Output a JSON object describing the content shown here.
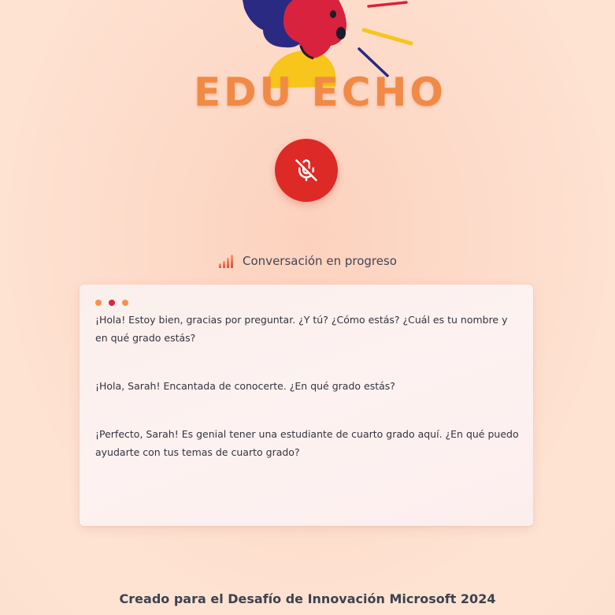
{
  "app": {
    "title": "EDU ECHO"
  },
  "mic": {
    "state": "muted",
    "icon": "mic-off-icon",
    "color": "#dd2a26"
  },
  "status": {
    "icon": "signal-bars-icon",
    "text": "Conversación en progreso"
  },
  "chat": {
    "window_dots": [
      "#f4944c",
      "#d92a3e",
      "#f4944c"
    ],
    "messages": [
      {
        "text": "¡Hola! Estoy bien, gracias por preguntar. ¿Y tú? ¿Cómo estás? ¿Cuál es tu nombre y en qué grado estás?"
      },
      {
        "text": "¡Hola, Sarah! Encantada de conocerte. ¿En qué grado estás?"
      },
      {
        "text": "¡Perfecto, Sarah! Es genial tener una estudiante de cuarto grado aquí. ¿En qué puedo ayudarte con tus temas de cuarto grado?"
      }
    ]
  },
  "footer": {
    "text": "Creado para el Desafío de Innovación Microsoft 2024"
  },
  "colors": {
    "accent_orange": "#f08a46",
    "mic_red": "#dd2a26",
    "logo_navy": "#2a2a82",
    "logo_crimson": "#d9223d",
    "logo_yellow": "#f7c51c"
  }
}
